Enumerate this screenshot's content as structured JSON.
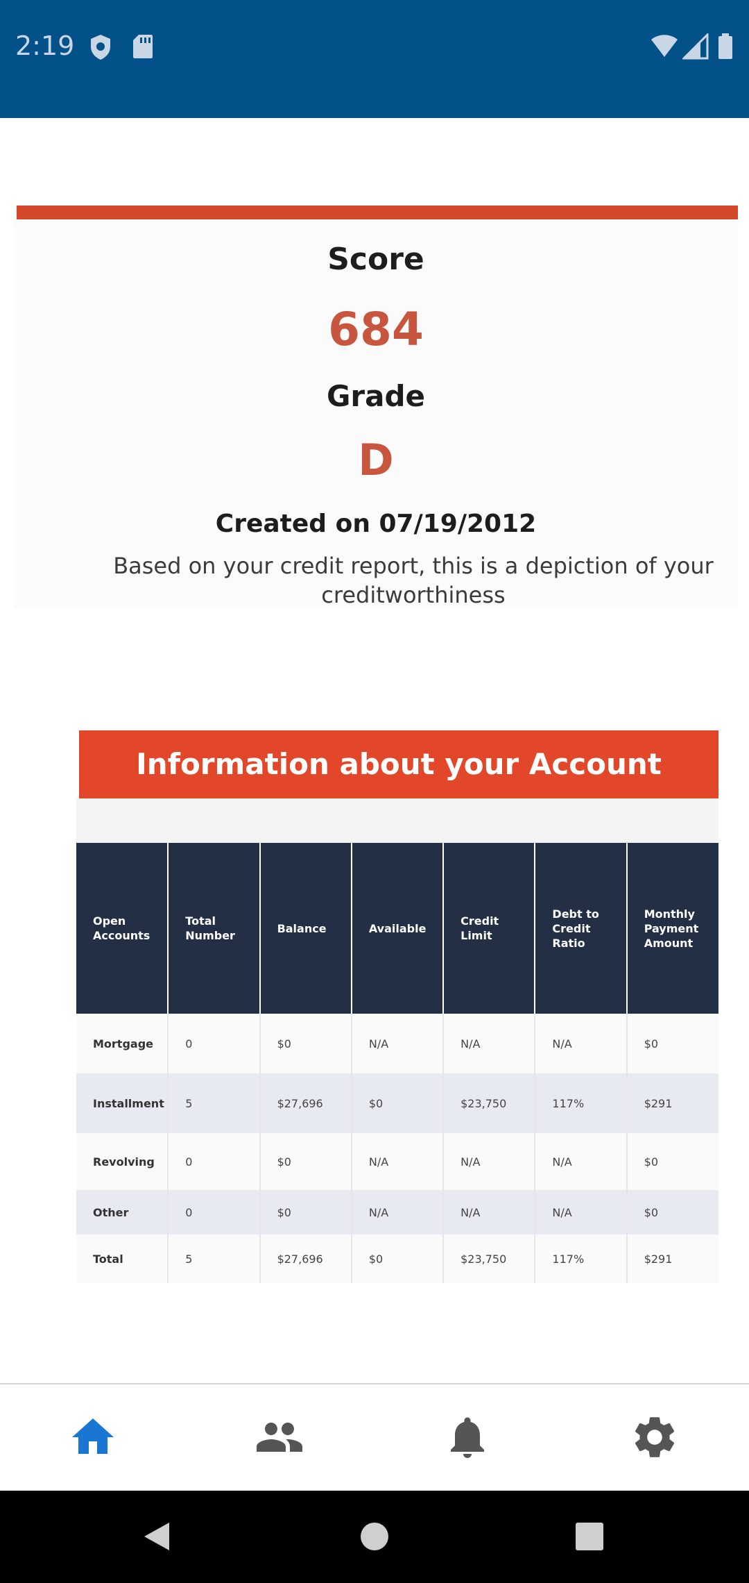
{
  "status_bar": {
    "time": "2:19",
    "icons": [
      "shield-icon",
      "sd-card-icon",
      "wifi-icon",
      "signal-icon",
      "battery-icon"
    ],
    "background": "#025189"
  },
  "score_card": {
    "score_label": "Score",
    "score_value": "684",
    "grade_label": "Grade",
    "grade_value": "D",
    "created": "Created on 07/19/2012",
    "description": "Based on your credit report, this is a depiction of your creditworthiness",
    "accent_color": "#d4492c"
  },
  "account": {
    "title": "Information about your Account",
    "banner_color": "#e2472a",
    "columns": [
      "Open Accounts",
      "Total Number",
      "Balance",
      "Available",
      "Credit Limit",
      "Debt to Credit Ratio",
      "Monthly Payment Amount"
    ],
    "rows": [
      [
        "Mortgage",
        "0",
        "$0",
        "N/A",
        "N/A",
        "N/A",
        "$0"
      ],
      [
        "Installment",
        "5",
        "$27,696",
        "$0",
        "$23,750",
        "117%",
        "$291"
      ],
      [
        "Revolving",
        "0",
        "$0",
        "N/A",
        "N/A",
        "N/A",
        "$0"
      ],
      [
        "Other",
        "0",
        "$0",
        "N/A",
        "N/A",
        "N/A",
        "$0"
      ],
      [
        "Total",
        "5",
        "$27,696",
        "$0",
        "$23,750",
        "117%",
        "$291"
      ]
    ],
    "header_color": "#222f44"
  },
  "bottom_nav": {
    "items": [
      {
        "icon": "home-icon",
        "active": true
      },
      {
        "icon": "people-icon",
        "active": false
      },
      {
        "icon": "bell-icon",
        "active": false
      },
      {
        "icon": "gear-icon",
        "active": false
      }
    ],
    "active_color": "#1976d2",
    "inactive_color": "#555555"
  },
  "system_nav": {
    "buttons": [
      "back-icon",
      "home-circle-icon",
      "recents-icon"
    ]
  }
}
